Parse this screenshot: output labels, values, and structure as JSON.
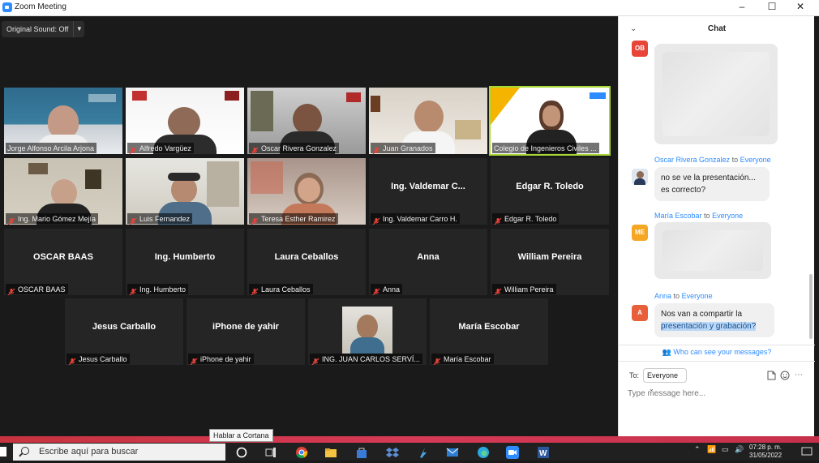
{
  "window": {
    "title": "Zoom Meeting"
  },
  "toolbar": {
    "original_sound": "Original Sound: Off"
  },
  "participants": [
    {
      "name": "Jorge Alfonso Arcila Arjona",
      "video": true,
      "muted": false
    },
    {
      "name": "Alfredo Vargüez",
      "video": true,
      "muted": true
    },
    {
      "name": "Oscar Rivera Gonzalez",
      "video": true,
      "muted": true
    },
    {
      "name": "Juan Granados",
      "video": true,
      "muted": true
    },
    {
      "name": "Colegio de Ingenieros Civiles ...",
      "video": true,
      "muted": false,
      "active_speaker": true
    },
    {
      "name": "Ing. Mario Gómez Mejía",
      "video": true,
      "muted": true
    },
    {
      "name": "Luis Fernandez",
      "video": true,
      "muted": true
    },
    {
      "name": "Teresa Esther Ramirez",
      "video": true,
      "muted": true
    },
    {
      "name": "Ing. Valdemar Carro H.",
      "display_name": "Ing. Valdemar C...",
      "video": false,
      "muted": true
    },
    {
      "name": "Edgar R. Toledo",
      "display_name": "Edgar R. Toledo",
      "video": false,
      "muted": true
    },
    {
      "name": "OSCAR BAAS",
      "display_name": "OSCAR BAAS",
      "video": false,
      "muted": true
    },
    {
      "name": "Ing. Humberto",
      "display_name": "Ing. Humberto",
      "video": false,
      "muted": true
    },
    {
      "name": "Laura Ceballos",
      "display_name": "Laura Ceballos",
      "video": false,
      "muted": true
    },
    {
      "name": "Anna",
      "display_name": "Anna",
      "video": false,
      "muted": true
    },
    {
      "name": "William Pereira",
      "display_name": "William Pereira",
      "video": false,
      "muted": true
    },
    {
      "name": "Jesus Carballo",
      "display_name": "Jesus Carballo",
      "video": false,
      "muted": true
    },
    {
      "name": "iPhone de yahir",
      "display_name": "iPhone de yahir",
      "video": false,
      "muted": true
    },
    {
      "name": "ING. JUAN CARLOS SERVÍ...",
      "video": true,
      "muted": true
    },
    {
      "name": "María Escobar",
      "display_name": "María Escobar",
      "video": false,
      "muted": true
    }
  ],
  "chat": {
    "title": "Chat",
    "messages": [
      {
        "avatar": "OB",
        "avatar_color": "#e8443a",
        "sender": "",
        "to": "",
        "text": "",
        "blurred": true
      },
      {
        "avatar": "",
        "avatar_color": "#4a6fa5",
        "sender": "Oscar Rivera Gonzalez",
        "to_word": "to",
        "to": "Everyone",
        "text_lines": [
          "no se ve la presentación...",
          "es correcto?"
        ]
      },
      {
        "avatar": "ME",
        "avatar_color": "#f5a623",
        "sender": "María Escobar",
        "to_word": "to",
        "to": "Everyone",
        "text": "",
        "blurred": true
      },
      {
        "avatar": "A",
        "avatar_color": "#e8603a",
        "sender": "Anna",
        "to_word": "to",
        "to": "Everyone",
        "text_lines": [
          "Nos van a compartir la",
          "presentación y grabación?"
        ]
      }
    ],
    "who_can_see": "Who can see your messages?",
    "to_label": "To:",
    "recipient": "Everyone",
    "input_placeholder": "Type message here..."
  },
  "tooltip": "Hablar a Cortana",
  "taskbar": {
    "search_placeholder": "Escribe aquí para buscar",
    "clock_time": "07:28 p. m.",
    "clock_date": "31/05/2022"
  },
  "colors": {
    "zoom_blue": "#2d8cff",
    "active_speaker": "#a7d935",
    "muted_red": "#e8443a"
  }
}
